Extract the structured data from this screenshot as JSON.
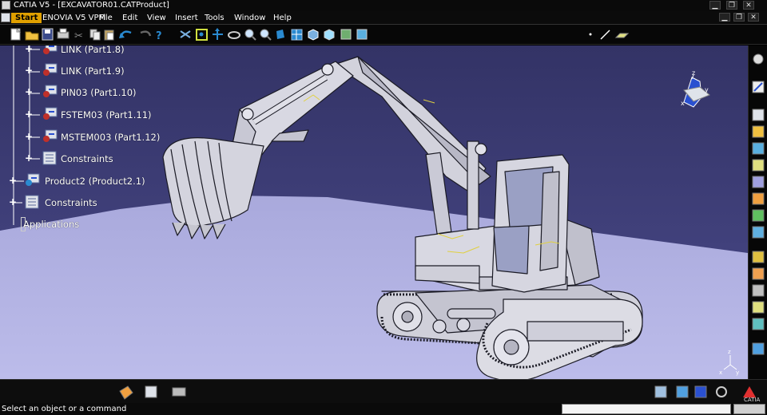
{
  "window": {
    "title": "CATIA V5 - [EXCAVATOR01.CATProduct]",
    "buttons": {
      "minimize": "▁",
      "restore": "❐",
      "close": "✕"
    },
    "doc_buttons": {
      "minimize": "▁",
      "restore": "❐",
      "close": "✕"
    }
  },
  "menu": {
    "start": "Start",
    "items": [
      "ENOVIA V5 VPM",
      "File",
      "Edit",
      "View",
      "Insert",
      "Tools",
      "Window",
      "Help"
    ]
  },
  "tree": {
    "items": [
      {
        "label": "LINK (Part1.8)"
      },
      {
        "label": "LINK (Part1.9)"
      },
      {
        "label": "PIN03 (Part1.10)"
      },
      {
        "label": "FSTEM03 (Part1.11)"
      },
      {
        "label": "MSTEM003 (Part1.12)"
      },
      {
        "label": "Constraints"
      },
      {
        "label": "Product2 (Product2.1)"
      },
      {
        "label": "Constraints"
      },
      {
        "label": "Applications"
      }
    ]
  },
  "compass": {
    "x": "x",
    "y": "y",
    "z": "z"
  },
  "axis_triad": {
    "x": "x",
    "y": "y",
    "z": "z"
  },
  "logo": {
    "text": "CATIA"
  },
  "status": {
    "message": "Select an object or a command"
  },
  "colors": {
    "viewport_top": "#333366",
    "floor": "#b3b3e0",
    "model": "#d4d4dc",
    "model_dark": "#9a9aa8",
    "tree_line": "#ffffff"
  }
}
